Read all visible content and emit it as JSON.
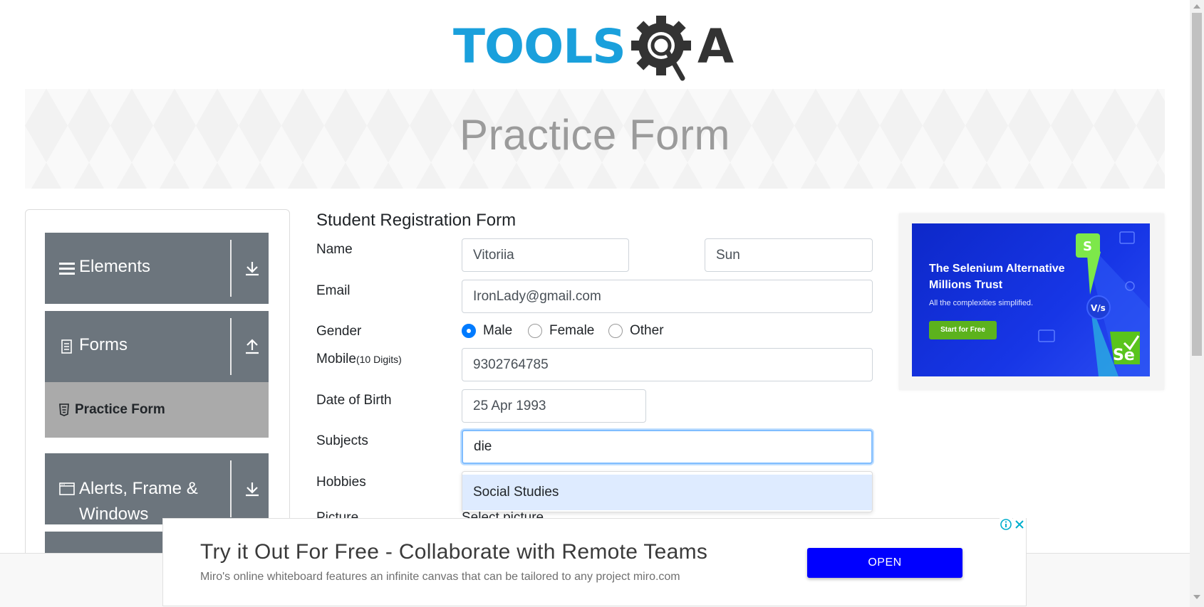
{
  "logo": {
    "text_left": "TOOLS",
    "text_right": "A",
    "icon": "gear-magnifier-icon"
  },
  "banner": {
    "title": "Practice Form"
  },
  "sidebar": {
    "groups": [
      {
        "label": "Elements",
        "icon": "hamburger-icon",
        "arrow": "download-arrow-icon"
      },
      {
        "label": "Forms",
        "icon": "document-icon",
        "arrow": "upload-arrow-icon"
      },
      {
        "label": "Alerts, Frame &",
        "label_line2": "Windows",
        "icon": "window-icon",
        "arrow": "download-arrow-icon"
      }
    ],
    "active_item": {
      "label": "Practice Form",
      "icon": "html5-icon"
    }
  },
  "form": {
    "title": "Student Registration Form",
    "name_label": "Name",
    "first_name": "Vitoriia",
    "last_name": "Sun",
    "email_label": "Email",
    "email": "IronLady@gmail.com",
    "gender_label": "Gender",
    "gender_options": [
      "Male",
      "Female",
      "Other"
    ],
    "gender_selected": "Male",
    "mobile_label": "Mobile",
    "mobile_hint": "(10 Digits)",
    "mobile": "9302764785",
    "dob_label": "Date of Birth",
    "dob": "25 Apr 1993",
    "subjects_label": "Subjects",
    "subjects_value": "die",
    "subjects_suggestion": "Social Studies",
    "hobbies_label": "Hobbies",
    "picture_label": "Picture",
    "picture_placeholder": "Select picture"
  },
  "side_ad": {
    "headline": "The Selenium Alternative Millions Trust",
    "sub": "All the complexities simplified.",
    "cta": "Start for Free",
    "badge_text": "Se",
    "vs_text": "V/s",
    "colors": {
      "bg": "#1736e6",
      "cta": "#5cb21d"
    }
  },
  "bottom_ad": {
    "title": "Try it Out For Free - Collaborate with Remote Teams",
    "description": "Miro's online whiteboard features an infinite canvas that can be tailored to any project miro.com",
    "button": "OPEN",
    "colors": {
      "button": "#0000ff"
    }
  },
  "colors": {
    "accent": "#007bff",
    "sidebar_bg": "#6c757d",
    "active_bg": "#aaaaaa",
    "logo_blue": "#1aa0dc"
  }
}
